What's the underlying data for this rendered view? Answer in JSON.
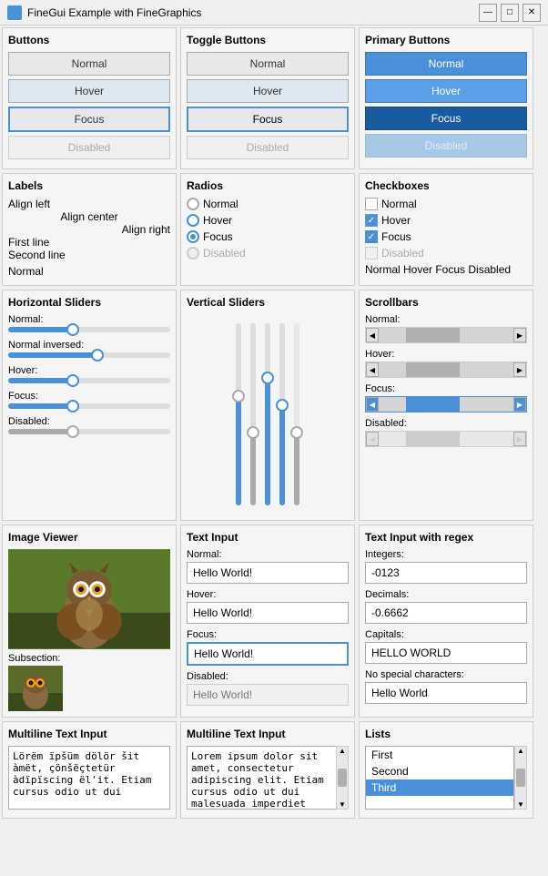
{
  "titleBar": {
    "title": "FineGui Example with FineGraphics",
    "minBtn": "—",
    "maxBtn": "□",
    "closeBtn": "✕"
  },
  "sections": {
    "buttons": {
      "title": "Buttons",
      "states": [
        "Normal",
        "Hover",
        "Focus",
        "Disabled"
      ]
    },
    "toggleButtons": {
      "title": "Toggle Buttons",
      "states": [
        "Normal",
        "Hover",
        "Focus",
        "Disabled"
      ]
    },
    "primaryButtons": {
      "title": "Primary Buttons",
      "states": [
        "Normal",
        "Hover",
        "Focus",
        "Disabled"
      ]
    },
    "labels": {
      "title": "Labels",
      "items": [
        "Align left",
        "Align center",
        "Align right",
        "First line",
        "Second line"
      ]
    },
    "radios": {
      "title": "Radios",
      "items": [
        "Normal",
        "Hover",
        "Focus",
        "Disabled"
      ]
    },
    "checkboxes": {
      "title": "Checkboxes",
      "items": [
        "Normal",
        "Hover",
        "Focus",
        "Disabled"
      ]
    },
    "hSliders": {
      "title": "Horizontal Sliders",
      "labels": [
        "Normal:",
        "Normal inversed:",
        "Hover:",
        "Focus:",
        "Disabled:"
      ]
    },
    "vSliders": {
      "title": "Vertical Sliders"
    },
    "scrollbars": {
      "title": "Scrollbars",
      "labels": [
        "Normal:",
        "Hover:",
        "Focus:",
        "Disabled:"
      ]
    },
    "imageViewer": {
      "title": "Image Viewer",
      "subsection": "Subsection:"
    },
    "textInput": {
      "title": "Text Input",
      "labels": [
        "Normal:",
        "Hover:",
        "Focus:",
        "Disabled:"
      ],
      "values": [
        "Hello World!",
        "Hello World!",
        "Hello World!",
        "Hello World!"
      ]
    },
    "textInputRegex": {
      "title": "Text Input with regex",
      "labels": [
        "Integers:",
        "Decimals:",
        "Capitals:",
        "No special characters:"
      ],
      "values": [
        "-0123",
        "-0.6662",
        "HELLO WORLD",
        "Hello World"
      ]
    },
    "multiline1": {
      "title": "Multiline Text Input",
      "value": "Lörëm ïpšüm dölör šit àmët, çönšëçtetür àdïpïscing ël'it. Etiam cursus odio ut dui"
    },
    "multiline2": {
      "title": "Multiline Text Input",
      "value": "Lorem ipsum dolor sit amet, consectetur adipiscing elit. Etiam cursus odio ut dui malesuada imperdiet"
    },
    "lists": {
      "title": "Lists",
      "items": [
        "First",
        "Second",
        "Third"
      ],
      "selectedIndex": 2
    }
  }
}
